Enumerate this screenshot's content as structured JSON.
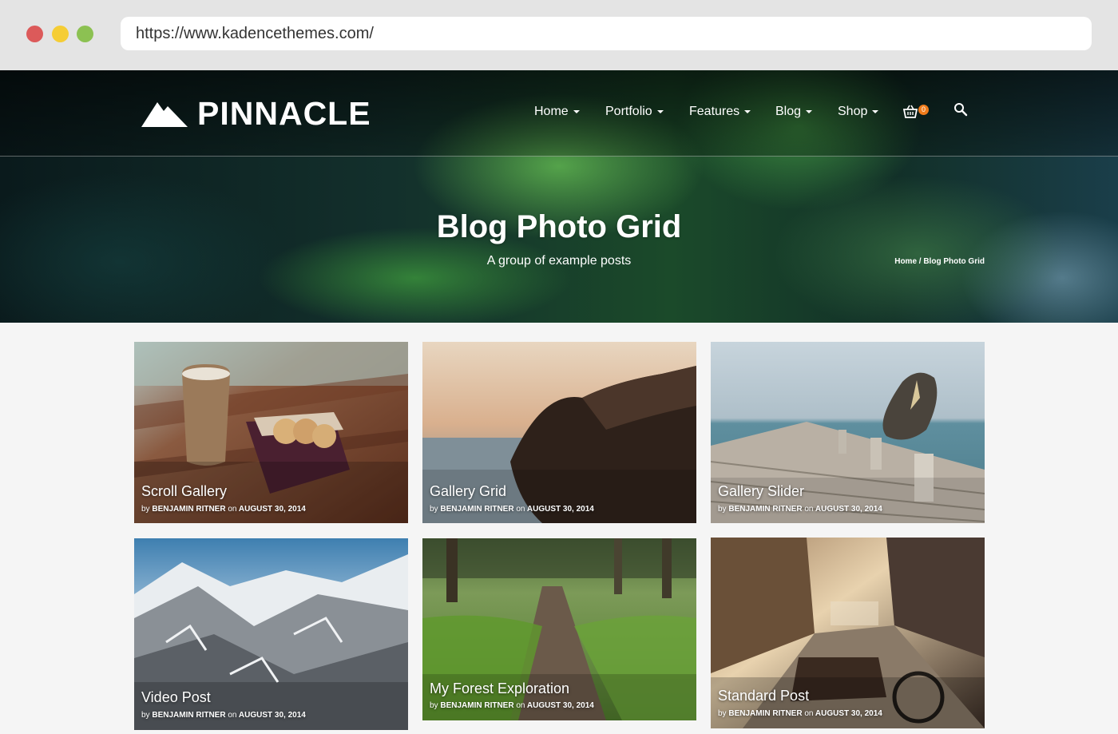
{
  "browser": {
    "url": "https://www.kadencethemes.com/"
  },
  "header": {
    "logo_text": "PINNACLE",
    "nav": [
      {
        "label": "Home"
      },
      {
        "label": "Portfolio"
      },
      {
        "label": "Features"
      },
      {
        "label": "Blog"
      },
      {
        "label": "Shop"
      }
    ],
    "cart_count": "0",
    "icons": [
      "mountain-logo-icon",
      "cart-icon",
      "search-icon"
    ],
    "accent_color": "#f07c1b"
  },
  "hero": {
    "title": "Blog Photo Grid",
    "subtitle": "A group of example posts",
    "breadcrumb": "Home / Blog Photo Grid"
  },
  "posts": [
    {
      "title": "Scroll Gallery",
      "by": "by",
      "author": "BENJAMIN RITNER",
      "on": "on",
      "date": "AUGUST 30, 2014"
    },
    {
      "title": "Gallery Grid",
      "by": "by",
      "author": "BENJAMIN RITNER",
      "on": "on",
      "date": "AUGUST 30, 2014"
    },
    {
      "title": "Gallery Slider",
      "by": "by",
      "author": "BENJAMIN RITNER",
      "on": "on",
      "date": "AUGUST 30, 2014"
    },
    {
      "title": "Video Post",
      "by": "by",
      "author": "BENJAMIN RITNER",
      "on": "on",
      "date": "AUGUST 30, 2014"
    },
    {
      "title": "My Forest Exploration",
      "by": "by",
      "author": "BENJAMIN RITNER",
      "on": "on",
      "date": "AUGUST 30, 2014"
    },
    {
      "title": "Standard Post",
      "by": "by",
      "author": "BENJAMIN RITNER",
      "on": "on",
      "date": "AUGUST 30, 2014"
    }
  ]
}
